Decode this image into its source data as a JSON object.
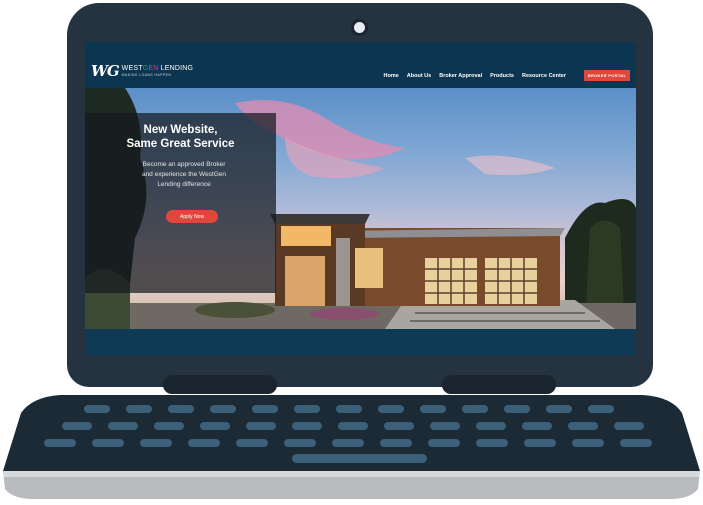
{
  "logo": {
    "mark": "WG",
    "brand_part1": "WEST",
    "brand_part2": "GEN",
    "brand_part3": " LENDING",
    "tagline": "MAKING LOANS HAPPEN"
  },
  "nav": {
    "items": [
      "Home",
      "About Us",
      "Broker Approval",
      "Products",
      "Resource Center"
    ],
    "portal_label": "BROKER PORTAL"
  },
  "hero": {
    "title_line1": "New Website,",
    "title_line2": "Same Great Service",
    "subtitle_line1": "Become an approved Broker",
    "subtitle_line2": "and experience the WestGen",
    "subtitle_line3": "Lending difference",
    "button_label": "Apply Now"
  },
  "colors": {
    "accent": "#e0463a",
    "nav_bg": "#0b3550",
    "laptop_body": "#253340"
  }
}
